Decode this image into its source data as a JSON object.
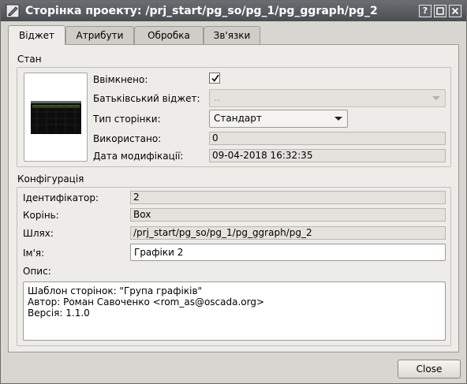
{
  "window": {
    "title": "Сторінка проекту: /prj_start/pg_so/pg_1/pg_ggraph/pg_2",
    "buttons": {
      "help": "?",
      "minimize": "",
      "maximize": "",
      "close": ""
    }
  },
  "tabs": [
    {
      "label": "Віджет"
    },
    {
      "label": "Атрибути"
    },
    {
      "label": "Обробка"
    },
    {
      "label": "Зв'язки"
    }
  ],
  "state": {
    "title": "Стан",
    "enabled_label": "Ввімкнено:",
    "enabled": true,
    "parent_label": "Батьківський віджет:",
    "parent_value": "..",
    "page_type_label": "Тип сторінки:",
    "page_type_value": "Стандарт",
    "used_label": "Використано:",
    "used_value": "0",
    "modified_label": "Дата модифікації:",
    "modified_value": "09-04-2018 16:32:35"
  },
  "config": {
    "title": "Конфігурація",
    "id_label": "Ідентифікатор:",
    "id_value": "2",
    "root_label": "Корінь:",
    "root_value": "Box",
    "path_label": "Шлях:",
    "path_value": "/prj_start/pg_so/pg_1/pg_ggraph/pg_2",
    "name_label": "Ім'я:",
    "name_value": "Графіки 2",
    "desc_label": "Опис:",
    "desc_value": "Шаблон сторінок: \"Група графіків\"\nАвтор: Роман Савоченко <rom_as@oscada.org>\nВерсія: 1.1.0"
  },
  "footer": {
    "close_label": "Close"
  },
  "colors": {
    "titlebar": "#5a5d62",
    "panel": "#eeece8",
    "field_ro": "#e4e2dd"
  },
  "icons": [
    "app-icon",
    "help-icon",
    "minimize-icon",
    "maximize-icon",
    "close-icon",
    "check-icon",
    "chevron-down-icon"
  ]
}
